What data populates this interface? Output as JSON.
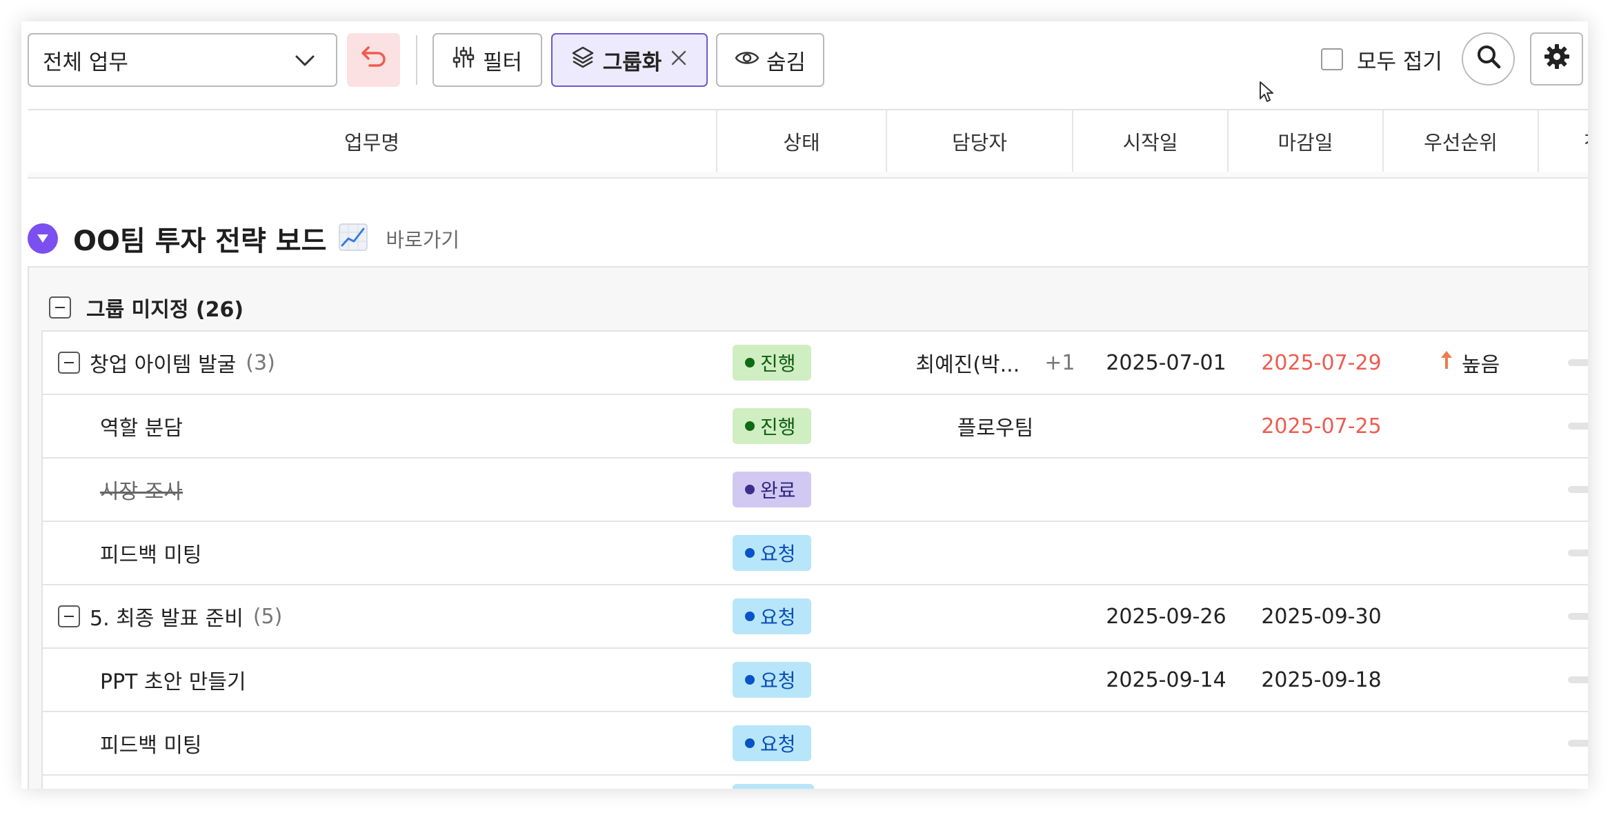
{
  "toolbar": {
    "view_select": "전체 업무",
    "filter_label": "필터",
    "group_label": "그룹화",
    "hide_label": "숨김",
    "collapse_all_label": "모두 접기"
  },
  "columns": [
    "업무명",
    "상태",
    "담당자",
    "시작일",
    "마감일",
    "우선순위",
    "진"
  ],
  "board": {
    "title": "OO팀 투자 전략 보드",
    "link_label": "바로가기"
  },
  "group": {
    "title": "그룹 미지정 (26)"
  },
  "rows": [
    {
      "name": "창업 아이템 발굴",
      "count": "(3)",
      "status": "진행",
      "owner": "최예진(박...",
      "owner_extra": "+1",
      "start": "2025-07-01",
      "due": "2025-07-29",
      "priority": "높음"
    },
    {
      "name": "역할 분담",
      "status": "진행",
      "owner": "플로우팀",
      "due": "2025-07-25"
    },
    {
      "name": "시장 조사",
      "status": "완료"
    },
    {
      "name": "피드백 미팅",
      "status": "요청"
    },
    {
      "name": "5. 최종 발표 준비",
      "count": "(5)",
      "status": "요청",
      "start": "2025-09-26",
      "due": "2025-09-30"
    },
    {
      "name": "PPT 초안 만들기",
      "status": "요청",
      "start": "2025-09-14",
      "due": "2025-09-18"
    },
    {
      "name": "피드백 미팅",
      "status": "요청"
    }
  ],
  "colors": {
    "accent": "#7b4ff0",
    "progress_bg": "#cfeec2",
    "progress_dot": "#0f6b12",
    "done_bg": "#d2c9f2",
    "done_dot": "#3b2e8c",
    "request_bg": "#b7e6fa",
    "request_dot": "#0a52c8",
    "overdue": "#ef5b50",
    "priority_high": "#ef7a4c"
  },
  "icons": [
    "chevron-down-icon",
    "undo-icon",
    "sliders-icon",
    "layers-icon",
    "close-icon",
    "eye-icon",
    "search-icon",
    "gear-icon",
    "caret-down-icon",
    "chart-emoji-icon",
    "arrow-up-icon",
    "cursor-icon"
  ]
}
